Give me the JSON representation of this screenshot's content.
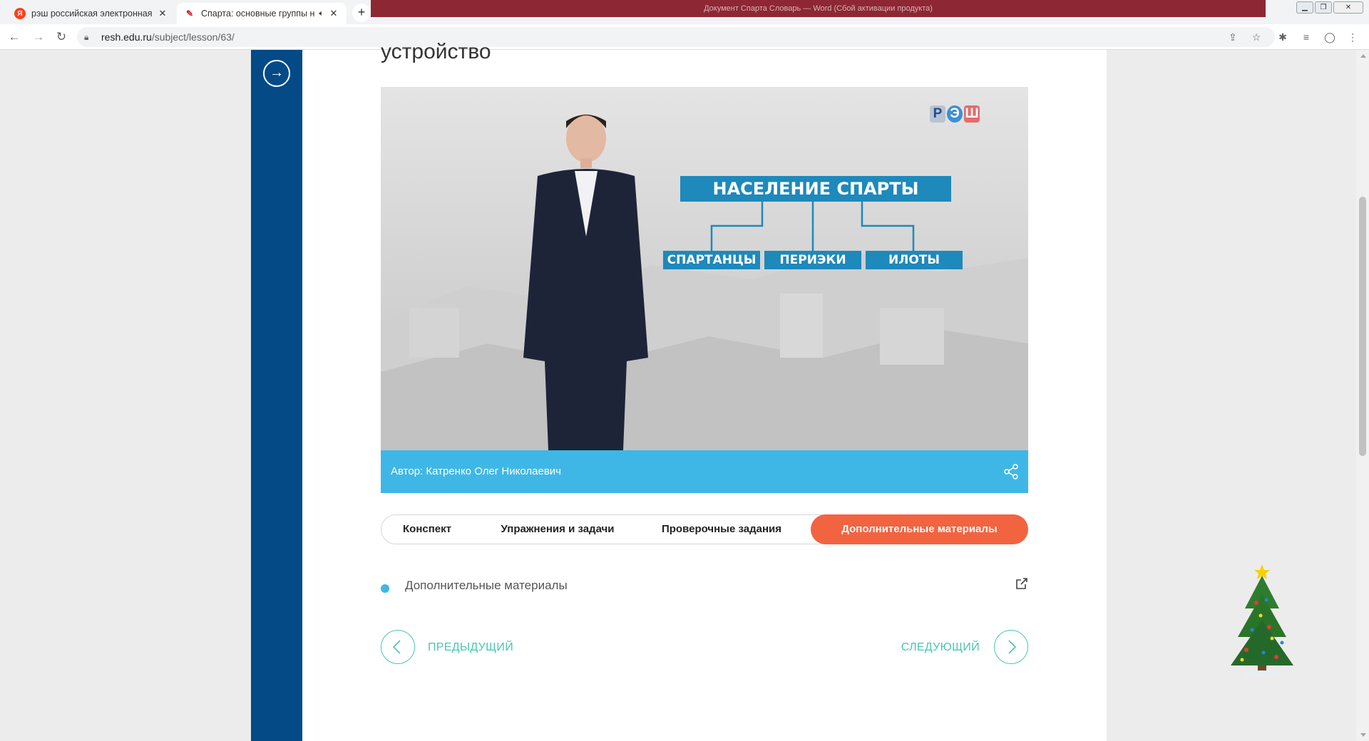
{
  "browser": {
    "tabs": [
      {
        "title": "рэш российская электронная ш",
        "favicon": "yandex-icon",
        "active": false
      },
      {
        "title": "Спарта: основные группы н",
        "favicon": "resh-icon",
        "active": true
      }
    ],
    "window_title": "Документ Спарта Словарь — Word (Сбой активации продукта)",
    "url_host": "resh.edu.ru",
    "url_path": "/subject/lesson/63/"
  },
  "lesson": {
    "title_partial": "устройство"
  },
  "video": {
    "logo_letters": [
      "Р",
      "Э",
      "Ш"
    ],
    "diagram_title": "НАСЕЛЕНИЕ СПАРТЫ",
    "diagram_items": [
      "СПАРТАНЦЫ",
      "ПЕРИЭКИ",
      "ИЛОТЫ"
    ]
  },
  "author": {
    "text": "Автор: Катренко Олег Николаевич"
  },
  "lesson_tabs": [
    {
      "label": "Конспект",
      "active": false
    },
    {
      "label": "Упражнения и задачи",
      "active": false
    },
    {
      "label": "Проверочные задания",
      "active": false
    },
    {
      "label": "Дополнительные материалы",
      "active": true
    }
  ],
  "materials": [
    {
      "label": "Дополнительные материалы"
    }
  ],
  "pager": {
    "prev_label": "ПРЕДЫДУЩИЙ",
    "next_label": "СЛЕДУЮЩИЙ"
  },
  "colors": {
    "sidebar": "#034a87",
    "author_bar": "#3fb7e6",
    "active_tab": "#f26340",
    "pager_accent": "#49c5b6",
    "diagram_label": "#1e89bb"
  }
}
